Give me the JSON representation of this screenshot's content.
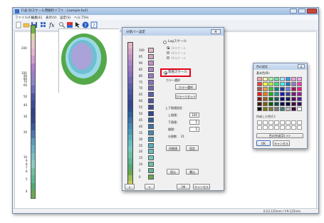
{
  "window": {
    "title": "FUJI DIスケール用解析ソフト - [sample.fud]"
  },
  "menu": [
    "ファイル(F)",
    "編集(E)",
    "表示(V)",
    "設定(S)",
    "ヘルプ(H)"
  ],
  "toolbar_icons": [
    "new-file-icon",
    "open-folder-icon",
    "save-icon",
    "grid-icon",
    "function-icon",
    "zoom-icon",
    "color-palette-icon",
    "cursor-icon",
    "help-icon",
    "about-icon"
  ],
  "main_scale": {
    "labels": [
      "200",
      "100",
      "90",
      "80",
      "70",
      "60",
      "50",
      "40",
      "30",
      "20",
      "10",
      "9",
      "8",
      "7",
      "6",
      "5",
      "4"
    ],
    "colors": [
      "#6fb33f",
      "#d9d9a0",
      "#e8c8c8",
      "#e5b5d0",
      "#d49ad0",
      "#b57fcf",
      "#9b7ec9",
      "#8c84c7",
      "#6d6fbf",
      "#4b55a6",
      "#3e4a99",
      "#34408a",
      "#35458f",
      "#3a5a9a",
      "#4c78b0",
      "#5d9bbd",
      "#6bb1c2",
      "#7cc0c1",
      "#8ccdbf",
      "#6fc1a0",
      "#5cb98f",
      "#4faa6e",
      "#6aa84f"
    ]
  },
  "status": {
    "coords": "X:23.125mm / Y:9.125mm"
  },
  "dialog": {
    "title": "分割バー設定",
    "close": "×",
    "bar_colors": [
      "#e4b8c6",
      "#d4a4c4",
      "#c294c6",
      "#ad86c8",
      "#9a7cc5",
      "#8a72c0",
      "#7468b6",
      "#5d5fae",
      "#4c57a5",
      "#3f4f9c",
      "#33468f",
      "#2f4f93",
      "#33609c",
      "#3c74a7",
      "#4488b0",
      "#4d9bb7",
      "#58aebb",
      "#66bdbf",
      "#74c8bf",
      "#6dbfa8",
      "#5fb492",
      "#54a87a",
      "#6aa84f",
      "#9bbf5a",
      "#c9c95f"
    ],
    "values": [
      "100",
      "95",
      "90",
      "85",
      "80",
      "75",
      "70",
      "65",
      "60",
      "55",
      "50",
      "45",
      "40",
      "35",
      "30",
      "25",
      "20",
      "15",
      "10",
      "5",
      "0"
    ],
    "swatch_colors": [
      "#e4b8c6",
      "#d4a4c4",
      "#c294c6",
      "#ad86c8",
      "#9a7cc5",
      "#8a72c0",
      "#7468b6",
      "#5d5fae",
      "#4c57a5",
      "#3f4f9c",
      "#33468f",
      "#33609c",
      "#3c74a7",
      "#4488b0",
      "#4d9bb7",
      "#58aebb",
      "#66bdbf",
      "#74c8bf",
      "#6dbfa8",
      "#5fb492",
      "#6aa84f"
    ],
    "log_label": "Logスケール",
    "log_options": [
      "10スケール",
      "10スケール",
      "10スケール"
    ],
    "equal_label": "等倍スケール",
    "color_select_label": "カラー選択",
    "color_select_btn": "カラー選択",
    "color_reset_btn": "カラーリセット",
    "limits_title": "上下限値設定",
    "upper_label": "上限値：",
    "upper_value": "100",
    "lower_label": "下限値：",
    "lower_value": "5",
    "step_label": "間隔：",
    "step_value": "5",
    "divisions_label": "分割数：",
    "divisions_value": "21",
    "init_btn": "初期値",
    "set_btn": "設定",
    "load_btn": "読込",
    "write_btn": "書込",
    "up_btn": "∧",
    "down_btn": "∨",
    "ok_btn": "OK",
    "cancel_btn": "キャンセル"
  },
  "color_dialog": {
    "title": "色の設定",
    "close": "×",
    "basic_label": "基本色(B):",
    "basic_colors": [
      "#f4a6a6",
      "#fff2a6",
      "#a6f2a6",
      "#66e0a6",
      "#a6e6ff",
      "#3399ff",
      "#e6a6d9",
      "#f0a6f0",
      "#f03c3c",
      "#ffff3c",
      "#a6ff3c",
      "#3ce07a",
      "#3cf0ff",
      "#1a7ac0",
      "#9a7ac0",
      "#f03cb4",
      "#a65252",
      "#f09a3c",
      "#3cc03c",
      "#0a8080",
      "#1a3c9a",
      "#7a7ae0",
      "#9a1a52",
      "#f01a7a",
      "#f01a1a",
      "#f0781a",
      "#1ab41a",
      "#1a9a9a",
      "#1a1ab4",
      "#3c3c9a",
      "#781a78",
      "#9a1a9a",
      "#7a1a1a",
      "#9a5a1a",
      "#1a6e1a",
      "#1a5a5a",
      "#0a0a7a",
      "#1a1a5a",
      "#5a0a5a",
      "#5a1a9a",
      "#3c1a0a",
      "#7a5a0a",
      "#0a5a0a",
      "#0a4a4a",
      "#0a0a4a",
      "#0a0a3c",
      "#3c0a3c",
      "#3c0a5a",
      "#000000",
      "#7a7a0a",
      "#7a7a3c",
      "#7a7a7a",
      "#3c7a7a",
      "#bcbcbc",
      "#3c0a3c",
      "#ffffff"
    ],
    "custom_label": "作成した色(C):",
    "define_btn": "色の作成(D) >>",
    "ok_btn": "OK",
    "cancel_btn": "キャンセル"
  }
}
